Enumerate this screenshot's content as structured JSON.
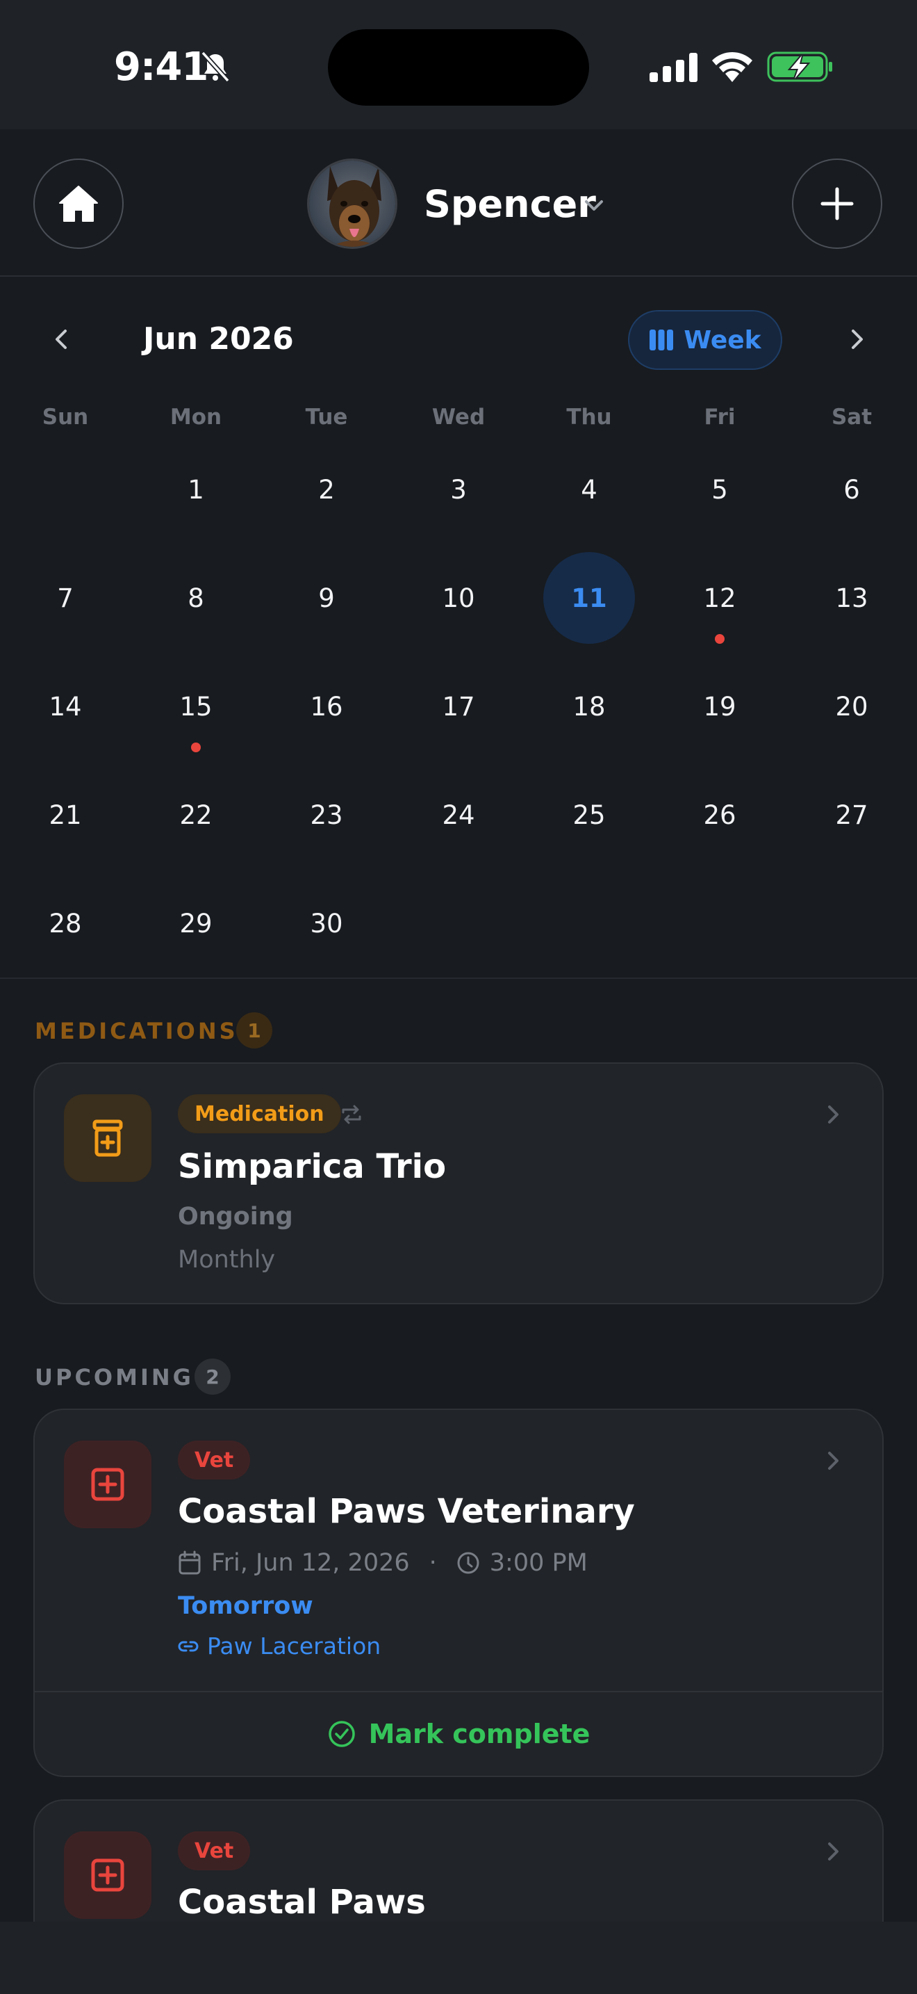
{
  "status_bar": {
    "time": "9:41",
    "icons": [
      "bell-slash-icon",
      "cellular-signal-icon",
      "wifi-icon",
      "battery-charging-icon"
    ]
  },
  "header": {
    "pet_name": "Spencer",
    "home_icon": "home-icon",
    "add_icon": "plus-icon"
  },
  "calendar": {
    "month_label": "Jun 2026",
    "view_toggle_label": "Week",
    "weekdays": [
      "Sun",
      "Mon",
      "Tue",
      "Wed",
      "Thu",
      "Fri",
      "Sat"
    ],
    "first_weekday_index": 1,
    "days_in_month": 30,
    "selected_day": 11,
    "days_with_events": [
      12,
      15
    ],
    "colors": {
      "selected_bg": "#162b48",
      "selected_text": "#3b8cf2",
      "event_dot": "#e9453d"
    }
  },
  "medications": {
    "section_label": "MEDICATIONS",
    "count": "1",
    "items": [
      {
        "tag": "Medication",
        "title": "Simparica Trio",
        "status": "Ongoing",
        "frequency": "Monthly"
      }
    ]
  },
  "upcoming": {
    "section_label": "UPCOMING",
    "count": "2",
    "items": [
      {
        "tag": "Vet",
        "title": "Coastal Paws Veterinary",
        "date": "Fri, Jun 12, 2026",
        "separator": "·",
        "time": "3:00 PM",
        "relative": "Tomorrow",
        "link": "Paw Laceration",
        "action": "Mark complete"
      },
      {
        "tag": "Vet",
        "title": "Coastal Paws"
      }
    ]
  },
  "colors": {
    "medication_accent": "#f29c18",
    "vet_accent": "#e9453d",
    "link_blue": "#3b8cf2",
    "success_green": "#35c45a"
  }
}
